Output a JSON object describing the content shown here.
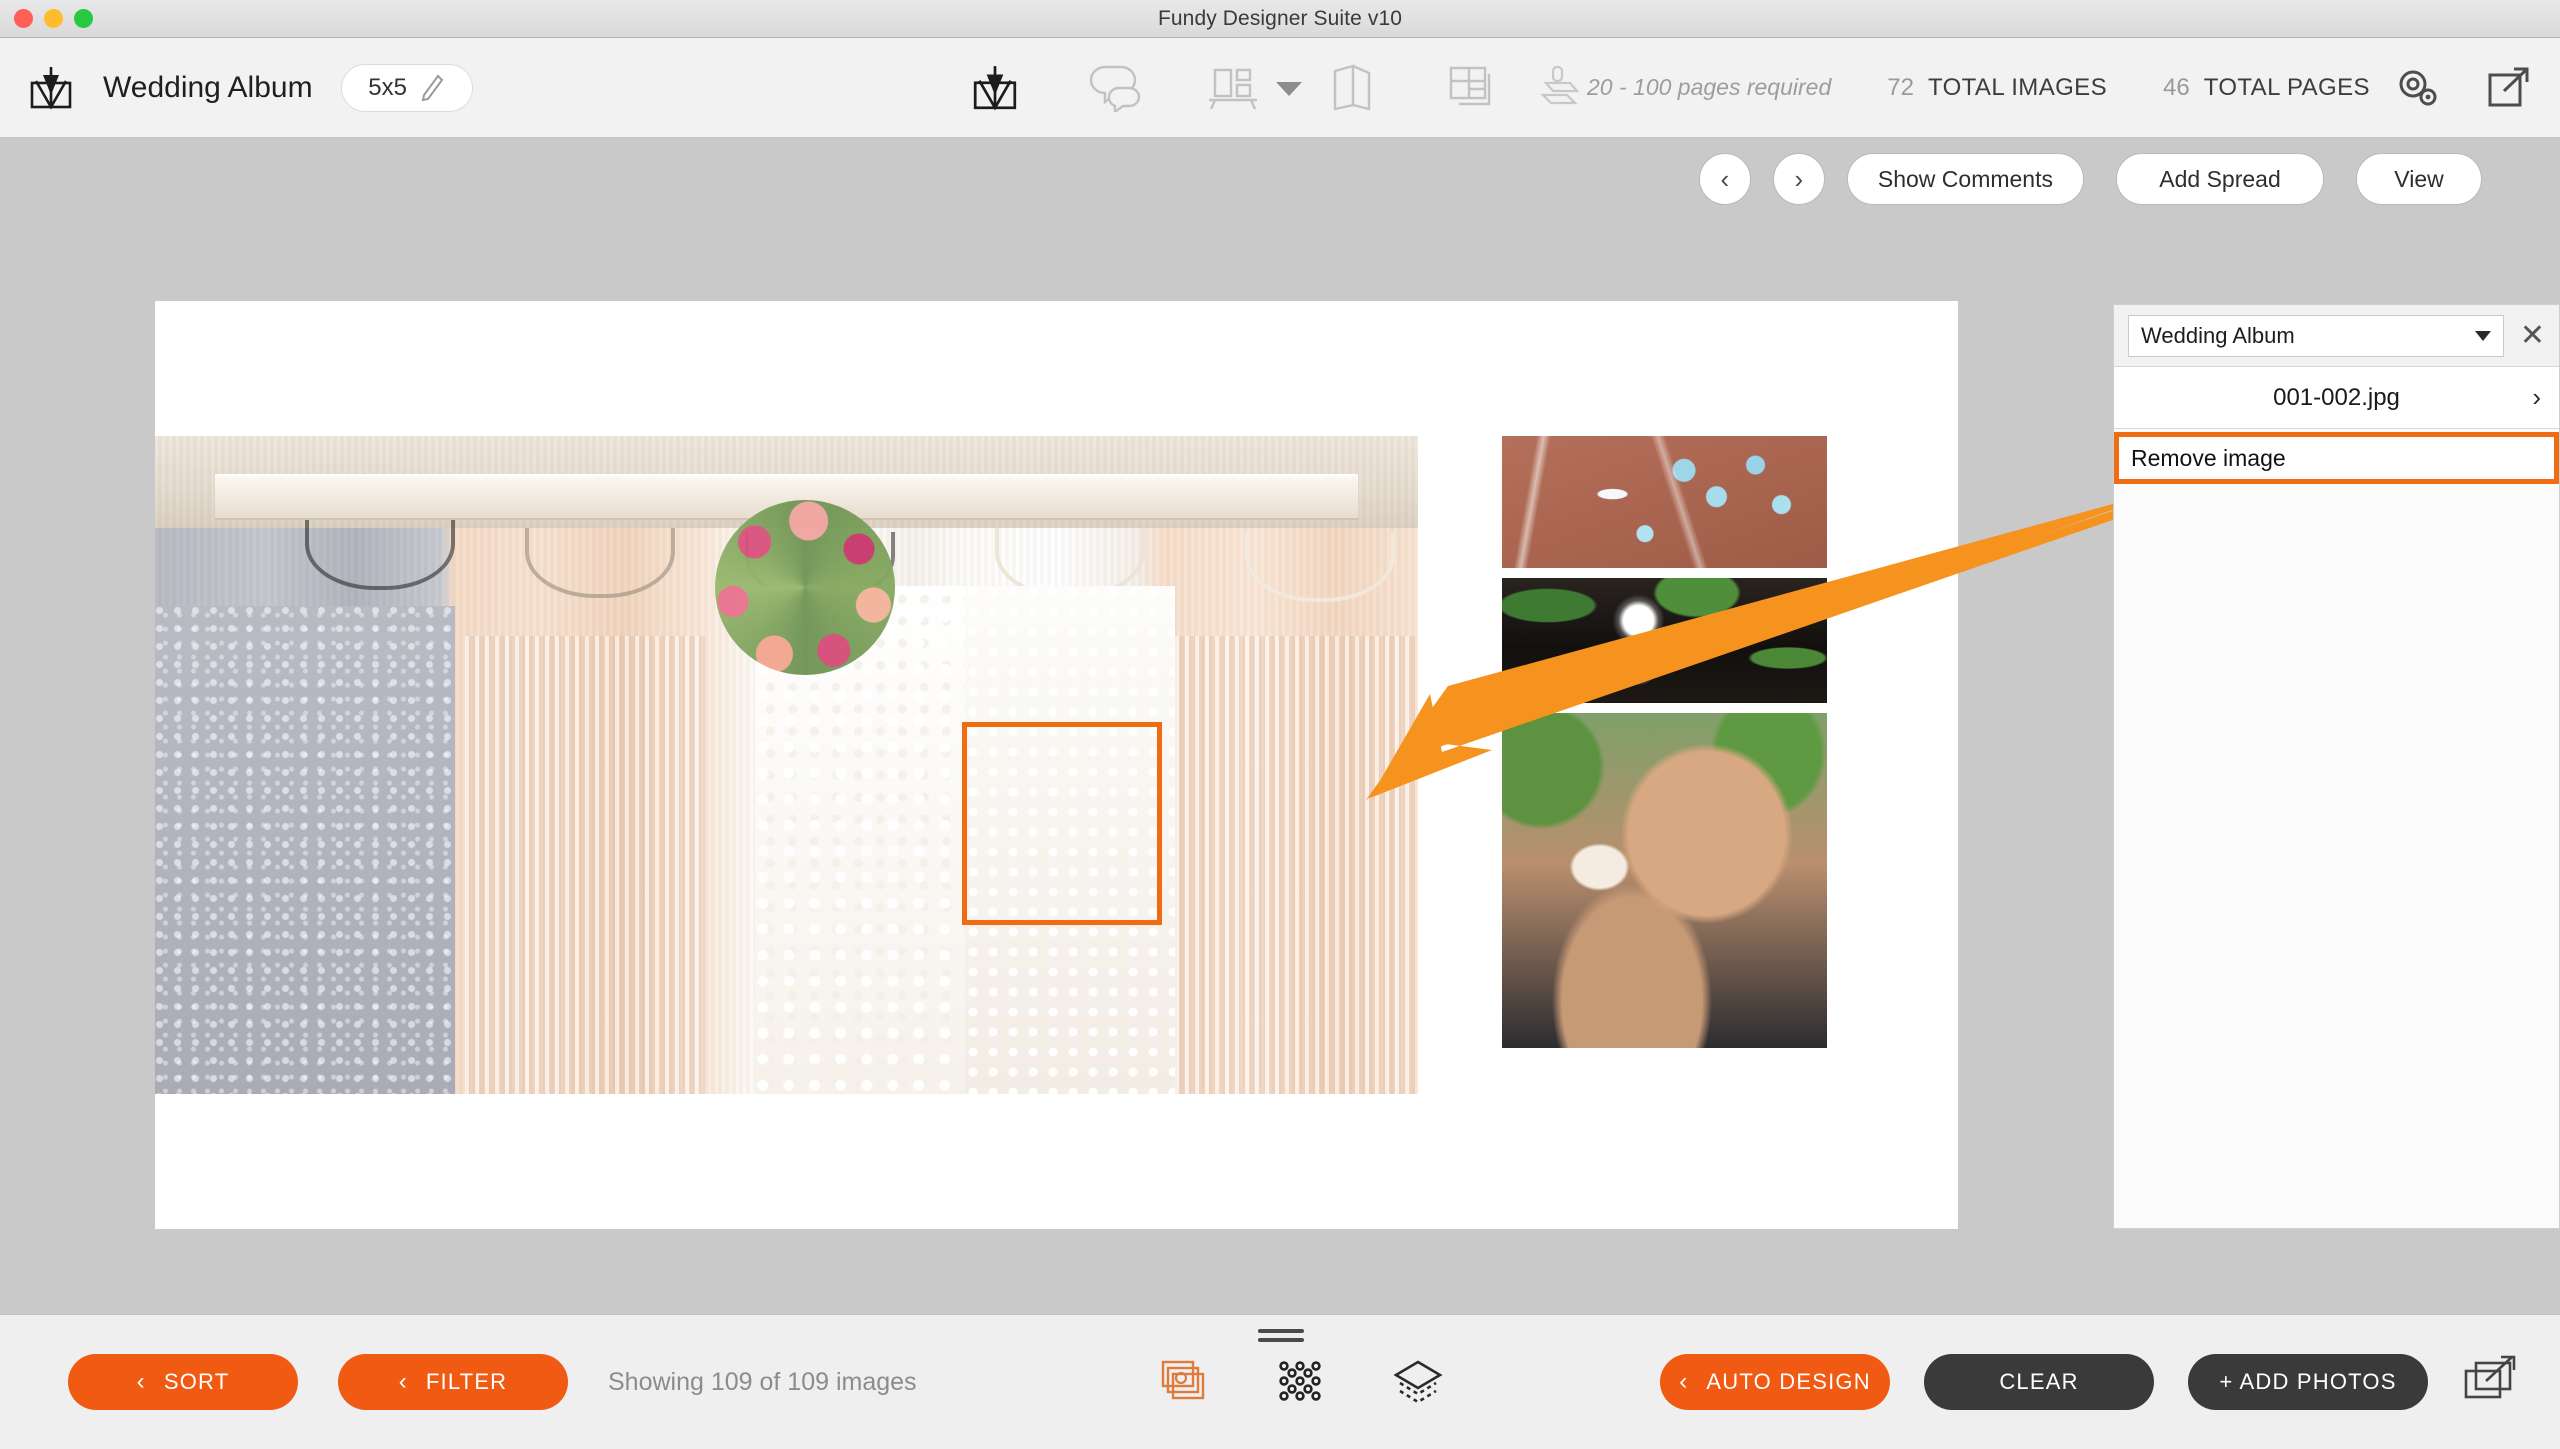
{
  "window": {
    "title": "Fundy Designer Suite v10",
    "traffic_lights": [
      "close",
      "minimize",
      "maximize"
    ]
  },
  "header": {
    "brand_icon": "fundy-crown-icon",
    "album_title": "Wedding Album",
    "size_badge": {
      "value": "5x5",
      "edit_icon": "pencil-icon"
    },
    "tools": [
      {
        "name": "album-design",
        "icon": "fundy-crown-icon",
        "active": true
      },
      {
        "name": "comments",
        "icon": "speech-bubbles-icon",
        "active": false
      },
      {
        "name": "wall-display",
        "icon": "wall-frames-icon",
        "active": false
      },
      {
        "name": "book-pages",
        "icon": "folded-pages-icon",
        "active": false
      },
      {
        "name": "layouts",
        "icon": "grid-layout-icon",
        "active": false
      }
    ],
    "pages_required": {
      "icon": "press-stamp-icon",
      "text": "20 - 100 pages required"
    },
    "total_images": {
      "count": "72",
      "label": "TOTAL IMAGES"
    },
    "total_pages": {
      "count": "46",
      "label": "TOTAL PAGES"
    },
    "right_icons": [
      {
        "name": "settings-gears-icon"
      },
      {
        "name": "export-arrow-icon"
      }
    ]
  },
  "navrow": {
    "prev_label": "‹",
    "next_label": "›",
    "show_comments": "Show Comments",
    "add_spread": "Add Spread",
    "view": "View"
  },
  "spread": {
    "main_photo_alt": "wedding dresses on hangers",
    "side_photos": [
      {
        "alt": "turquoise necklaces and ring on terracotta"
      },
      {
        "alt": "diamond ring on dark reflective surface with greenery"
      },
      {
        "alt": "hands wearing pearl flower bracelet"
      }
    ]
  },
  "annotations": {
    "color": "#ef6c12",
    "highlight_rect": "selected-image-cell",
    "arrow": "points-from-remove-image-to-selected-cell"
  },
  "panel": {
    "album_select": "Wedding Album",
    "close_label": "✕",
    "file_row": {
      "name": "001-002.jpg",
      "chevron": "›"
    },
    "action": "Remove image"
  },
  "footer": {
    "sort": "SORT",
    "filter": "FILTER",
    "showing": "Showing 109 of 109 images",
    "center_icons": [
      {
        "name": "photo-stack-icon"
      },
      {
        "name": "dots-grid-icon"
      },
      {
        "name": "layers-icon"
      }
    ],
    "auto_design": "AUTO DESIGN",
    "clear": "CLEAR",
    "add_photos": "+ ADD PHOTOS",
    "export_icon": "export-frames-icon",
    "chevron": "‹"
  }
}
